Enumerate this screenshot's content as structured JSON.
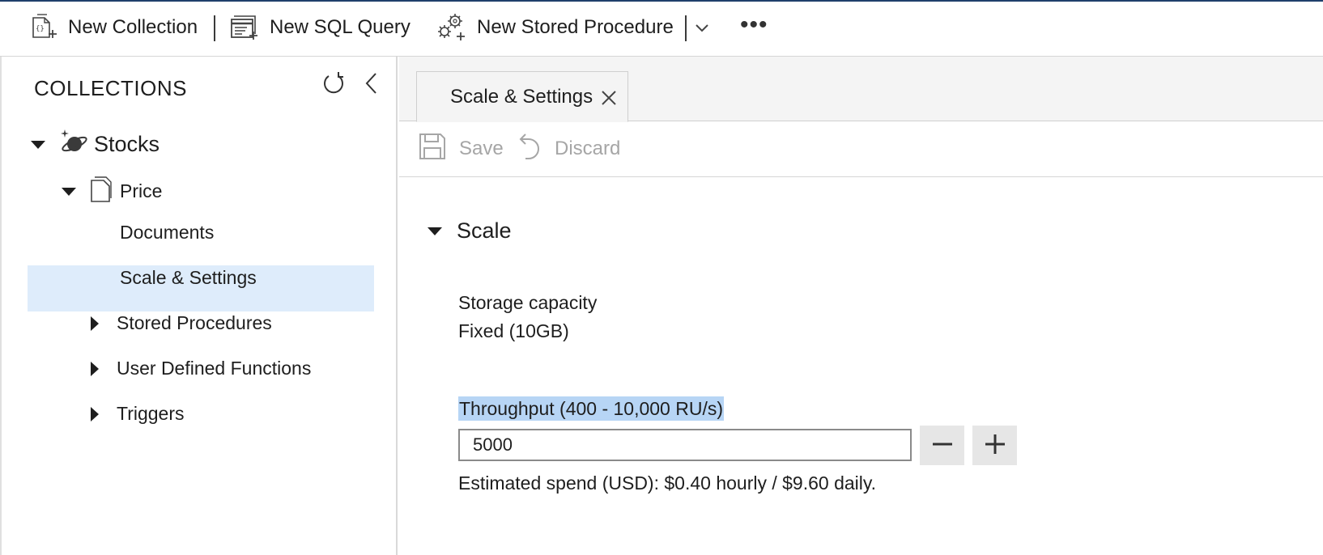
{
  "toolbar": {
    "new_collection": "New Collection",
    "new_sql_query": "New SQL Query",
    "new_stored_procedure": "New Stored Procedure",
    "more": "•••"
  },
  "sidebar": {
    "title": "COLLECTIONS",
    "database": "Stocks",
    "collection": "Price",
    "items": [
      {
        "label": "Documents"
      },
      {
        "label": "Scale & Settings",
        "selected": true
      },
      {
        "label": "Stored Procedures"
      },
      {
        "label": "User Defined Functions"
      },
      {
        "label": "Triggers"
      }
    ]
  },
  "tabs": [
    {
      "label": "Scale & Settings",
      "active": true
    }
  ],
  "actions": {
    "save": "Save",
    "discard": "Discard"
  },
  "scale": {
    "section_title": "Scale",
    "storage_label": "Storage capacity",
    "storage_value": "Fixed (10GB)",
    "throughput_label": "Throughput (400 - 10,000 RU/s)",
    "throughput_value": "5000",
    "spend_prefix": "Estimated spend (USD): ",
    "spend_value": "$0.40 hourly / $9.60 daily."
  },
  "colors": {
    "selected_bg": "#deecfb",
    "highlight": "#b7d5f5",
    "disabled_text": "#a6a6a6"
  }
}
